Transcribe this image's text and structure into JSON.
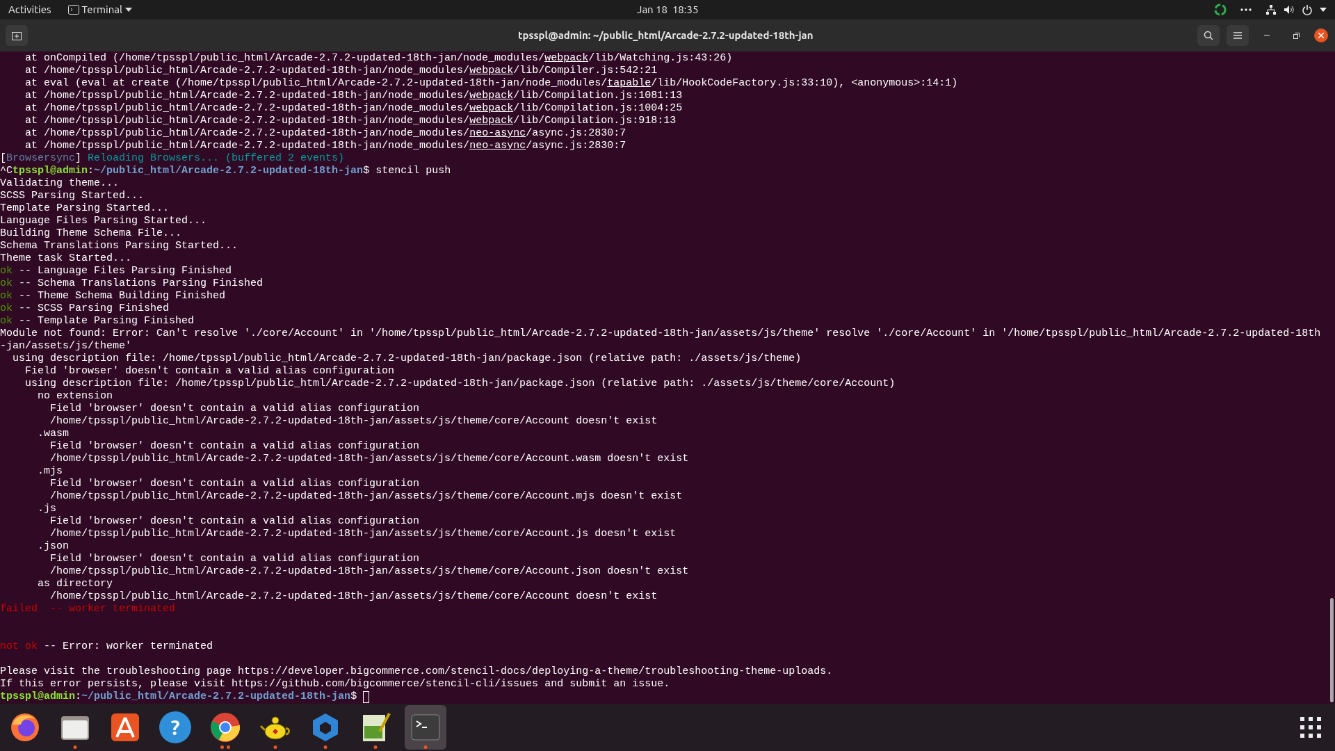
{
  "top_bar": {
    "activities": "Activities",
    "app_menu": "Terminal",
    "clock": "Jan 18  18:35"
  },
  "window": {
    "title": "tpsspl@admin: ~/public_html/Arcade-2.7.2-updated-18th-jan"
  },
  "terminal": {
    "lines": [
      [
        {
          "kind": "plain",
          "text": "    at onCompiled (/home/tpsspl/public_html/Arcade-2.7.2-updated-18th-jan/node_modules/"
        },
        {
          "kind": "link",
          "text": "webpack"
        },
        {
          "kind": "plain",
          "text": "/lib/Watching.js:43:26)"
        }
      ],
      [
        {
          "kind": "plain",
          "text": "    at /home/tpsspl/public_html/Arcade-2.7.2-updated-18th-jan/node_modules/"
        },
        {
          "kind": "link",
          "text": "webpack"
        },
        {
          "kind": "plain",
          "text": "/lib/Compiler.js:542:21"
        }
      ],
      [
        {
          "kind": "plain",
          "text": "    at eval (eval at create (/home/tpsspl/public_html/Arcade-2.7.2-updated-18th-jan/node_modules/"
        },
        {
          "kind": "link",
          "text": "tapable"
        },
        {
          "kind": "plain",
          "text": "/lib/HookCodeFactory.js:33:10), <anonymous>:14:1)"
        }
      ],
      [
        {
          "kind": "plain",
          "text": "    at /home/tpsspl/public_html/Arcade-2.7.2-updated-18th-jan/node_modules/"
        },
        {
          "kind": "link",
          "text": "webpack"
        },
        {
          "kind": "plain",
          "text": "/lib/Compilation.js:1081:13"
        }
      ],
      [
        {
          "kind": "plain",
          "text": "    at /home/tpsspl/public_html/Arcade-2.7.2-updated-18th-jan/node_modules/"
        },
        {
          "kind": "link",
          "text": "webpack"
        },
        {
          "kind": "plain",
          "text": "/lib/Compilation.js:1004:25"
        }
      ],
      [
        {
          "kind": "plain",
          "text": "    at /home/tpsspl/public_html/Arcade-2.7.2-updated-18th-jan/node_modules/"
        },
        {
          "kind": "link",
          "text": "webpack"
        },
        {
          "kind": "plain",
          "text": "/lib/Compilation.js:918:13"
        }
      ],
      [
        {
          "kind": "plain",
          "text": "    at /home/tpsspl/public_html/Arcade-2.7.2-updated-18th-jan/node_modules/"
        },
        {
          "kind": "link",
          "text": "neo-async"
        },
        {
          "kind": "plain",
          "text": "/async.js:2830:7"
        }
      ],
      [
        {
          "kind": "plain",
          "text": "    at /home/tpsspl/public_html/Arcade-2.7.2-updated-18th-jan/node_modules/"
        },
        {
          "kind": "link",
          "text": "neo-async"
        },
        {
          "kind": "plain",
          "text": "/async.js:2830:7"
        }
      ],
      [
        {
          "kind": "plain",
          "text": "["
        },
        {
          "kind": "muted",
          "text": "Browsersync"
        },
        {
          "kind": "plain",
          "text": "]"
        },
        {
          "kind": "info",
          "text": " Reloading Browsers... (buffered 2 events)"
        }
      ],
      [
        {
          "kind": "plain",
          "text": "^C"
        },
        {
          "kind": "user",
          "text": "tpsspl@admin"
        },
        {
          "kind": "plain",
          "text": ":"
        },
        {
          "kind": "path",
          "text": "~/public_html/Arcade-2.7.2-updated-18th-jan"
        },
        {
          "kind": "plain",
          "text": "$ stencil push"
        }
      ],
      "Validating theme...",
      "SCSS Parsing Started...",
      "Template Parsing Started...",
      "Language Files Parsing Started...",
      "Building Theme Schema File...",
      "Schema Translations Parsing Started...",
      "Theme task Started...",
      [
        {
          "kind": "ok",
          "text": "ok"
        },
        {
          "kind": "plain",
          "text": " -- Language Files Parsing Finished"
        }
      ],
      [
        {
          "kind": "ok",
          "text": "ok"
        },
        {
          "kind": "plain",
          "text": " -- Schema Translations Parsing Finished"
        }
      ],
      [
        {
          "kind": "ok",
          "text": "ok"
        },
        {
          "kind": "plain",
          "text": " -- Theme Schema Building Finished"
        }
      ],
      [
        {
          "kind": "ok",
          "text": "ok"
        },
        {
          "kind": "plain",
          "text": " -- SCSS Parsing Finished"
        }
      ],
      [
        {
          "kind": "ok",
          "text": "ok"
        },
        {
          "kind": "plain",
          "text": " -- Template Parsing Finished"
        }
      ],
      "Module not found: Error: Can't resolve './core/Account' in '/home/tpsspl/public_html/Arcade-2.7.2-updated-18th-jan/assets/js/theme' resolve './core/Account' in '/home/tpsspl/public_html/Arcade-2.7.2-updated-18th",
      "-jan/assets/js/theme'",
      "  using description file: /home/tpsspl/public_html/Arcade-2.7.2-updated-18th-jan/package.json (relative path: ./assets/js/theme)",
      "    Field 'browser' doesn't contain a valid alias configuration",
      "    using description file: /home/tpsspl/public_html/Arcade-2.7.2-updated-18th-jan/package.json (relative path: ./assets/js/theme/core/Account)",
      "      no extension",
      "        Field 'browser' doesn't contain a valid alias configuration",
      "        /home/tpsspl/public_html/Arcade-2.7.2-updated-18th-jan/assets/js/theme/core/Account doesn't exist",
      "      .wasm",
      "        Field 'browser' doesn't contain a valid alias configuration",
      "        /home/tpsspl/public_html/Arcade-2.7.2-updated-18th-jan/assets/js/theme/core/Account.wasm doesn't exist",
      "      .mjs",
      "        Field 'browser' doesn't contain a valid alias configuration",
      "        /home/tpsspl/public_html/Arcade-2.7.2-updated-18th-jan/assets/js/theme/core/Account.mjs doesn't exist",
      "      .js",
      "        Field 'browser' doesn't contain a valid alias configuration",
      "        /home/tpsspl/public_html/Arcade-2.7.2-updated-18th-jan/assets/js/theme/core/Account.js doesn't exist",
      "      .json",
      "        Field 'browser' doesn't contain a valid alias configuration",
      "        /home/tpsspl/public_html/Arcade-2.7.2-updated-18th-jan/assets/js/theme/core/Account.json doesn't exist",
      "      as directory",
      "        /home/tpsspl/public_html/Arcade-2.7.2-updated-18th-jan/assets/js/theme/core/Account doesn't exist",
      [
        {
          "kind": "error",
          "text": "failed  -- worker terminated"
        }
      ],
      {
        "kind": "blank"
      },
      {
        "kind": "blank"
      },
      [
        {
          "kind": "error",
          "text": "not ok"
        },
        {
          "kind": "plain",
          "text": " -- Error: worker terminated"
        }
      ],
      {
        "kind": "blank"
      },
      "Please visit the troubleshooting page https://developer.bigcommerce.com/stencil-docs/deploying-a-theme/troubleshooting-theme-uploads.",
      "If this error persists, please visit https://github.com/bigcommerce/stencil-cli/issues and submit an issue.",
      [
        {
          "kind": "user",
          "text": "tpsspl@admin"
        },
        {
          "kind": "plain",
          "text": ":"
        },
        {
          "kind": "path",
          "text": "~/public_html/Arcade-2.7.2-updated-18th-jan"
        },
        {
          "kind": "plain",
          "text": "$ "
        },
        {
          "kind": "cursor"
        }
      ]
    ]
  },
  "dock": [
    {
      "kind": "firefox",
      "running": false,
      "selected": false
    },
    {
      "kind": "files",
      "running": true,
      "selected": false
    },
    {
      "kind": "store",
      "running": false,
      "selected": false
    },
    {
      "kind": "help",
      "glyph": "?",
      "running": false,
      "selected": false
    },
    {
      "kind": "chrome",
      "running": true,
      "multiple": true,
      "selected": false
    },
    {
      "kind": "teapot",
      "running": true,
      "selected": false
    },
    {
      "kind": "hub",
      "running": true,
      "selected": false
    },
    {
      "kind": "editor",
      "running": true,
      "selected": false
    },
    {
      "kind": "terminal",
      "running": true,
      "selected": true
    }
  ]
}
